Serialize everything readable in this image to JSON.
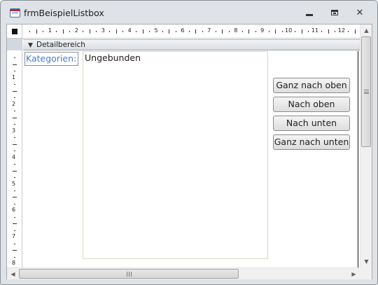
{
  "window": {
    "title": "frmBeispielListbox",
    "close_glyph": "✕"
  },
  "rulers": {
    "horizontal_numbers": [
      "1",
      "2",
      "3",
      "4",
      "5",
      "6",
      "7",
      "8",
      "9",
      "10",
      "11",
      "12"
    ],
    "vertical_numbers": [
      "1",
      "2",
      "3",
      "4",
      "5",
      "6",
      "7",
      "8"
    ]
  },
  "section": {
    "label": "Detailbereich",
    "icon": "arrow-down-icon"
  },
  "form": {
    "label": "Kategorien:",
    "listbox_text": "Ungebunden",
    "buttons": [
      "Ganz nach oben",
      "Nach oben",
      "Nach unten",
      "Ganz nach unten"
    ]
  },
  "scrollbars": {
    "up_glyph": "▲",
    "down_glyph": "▼",
    "left_glyph": "◀",
    "right_glyph": "▶"
  },
  "colors": {
    "label_text": "#4a7cc7",
    "window_frame": "#dfe3e8",
    "listbox_border": "#d9d5c4"
  }
}
